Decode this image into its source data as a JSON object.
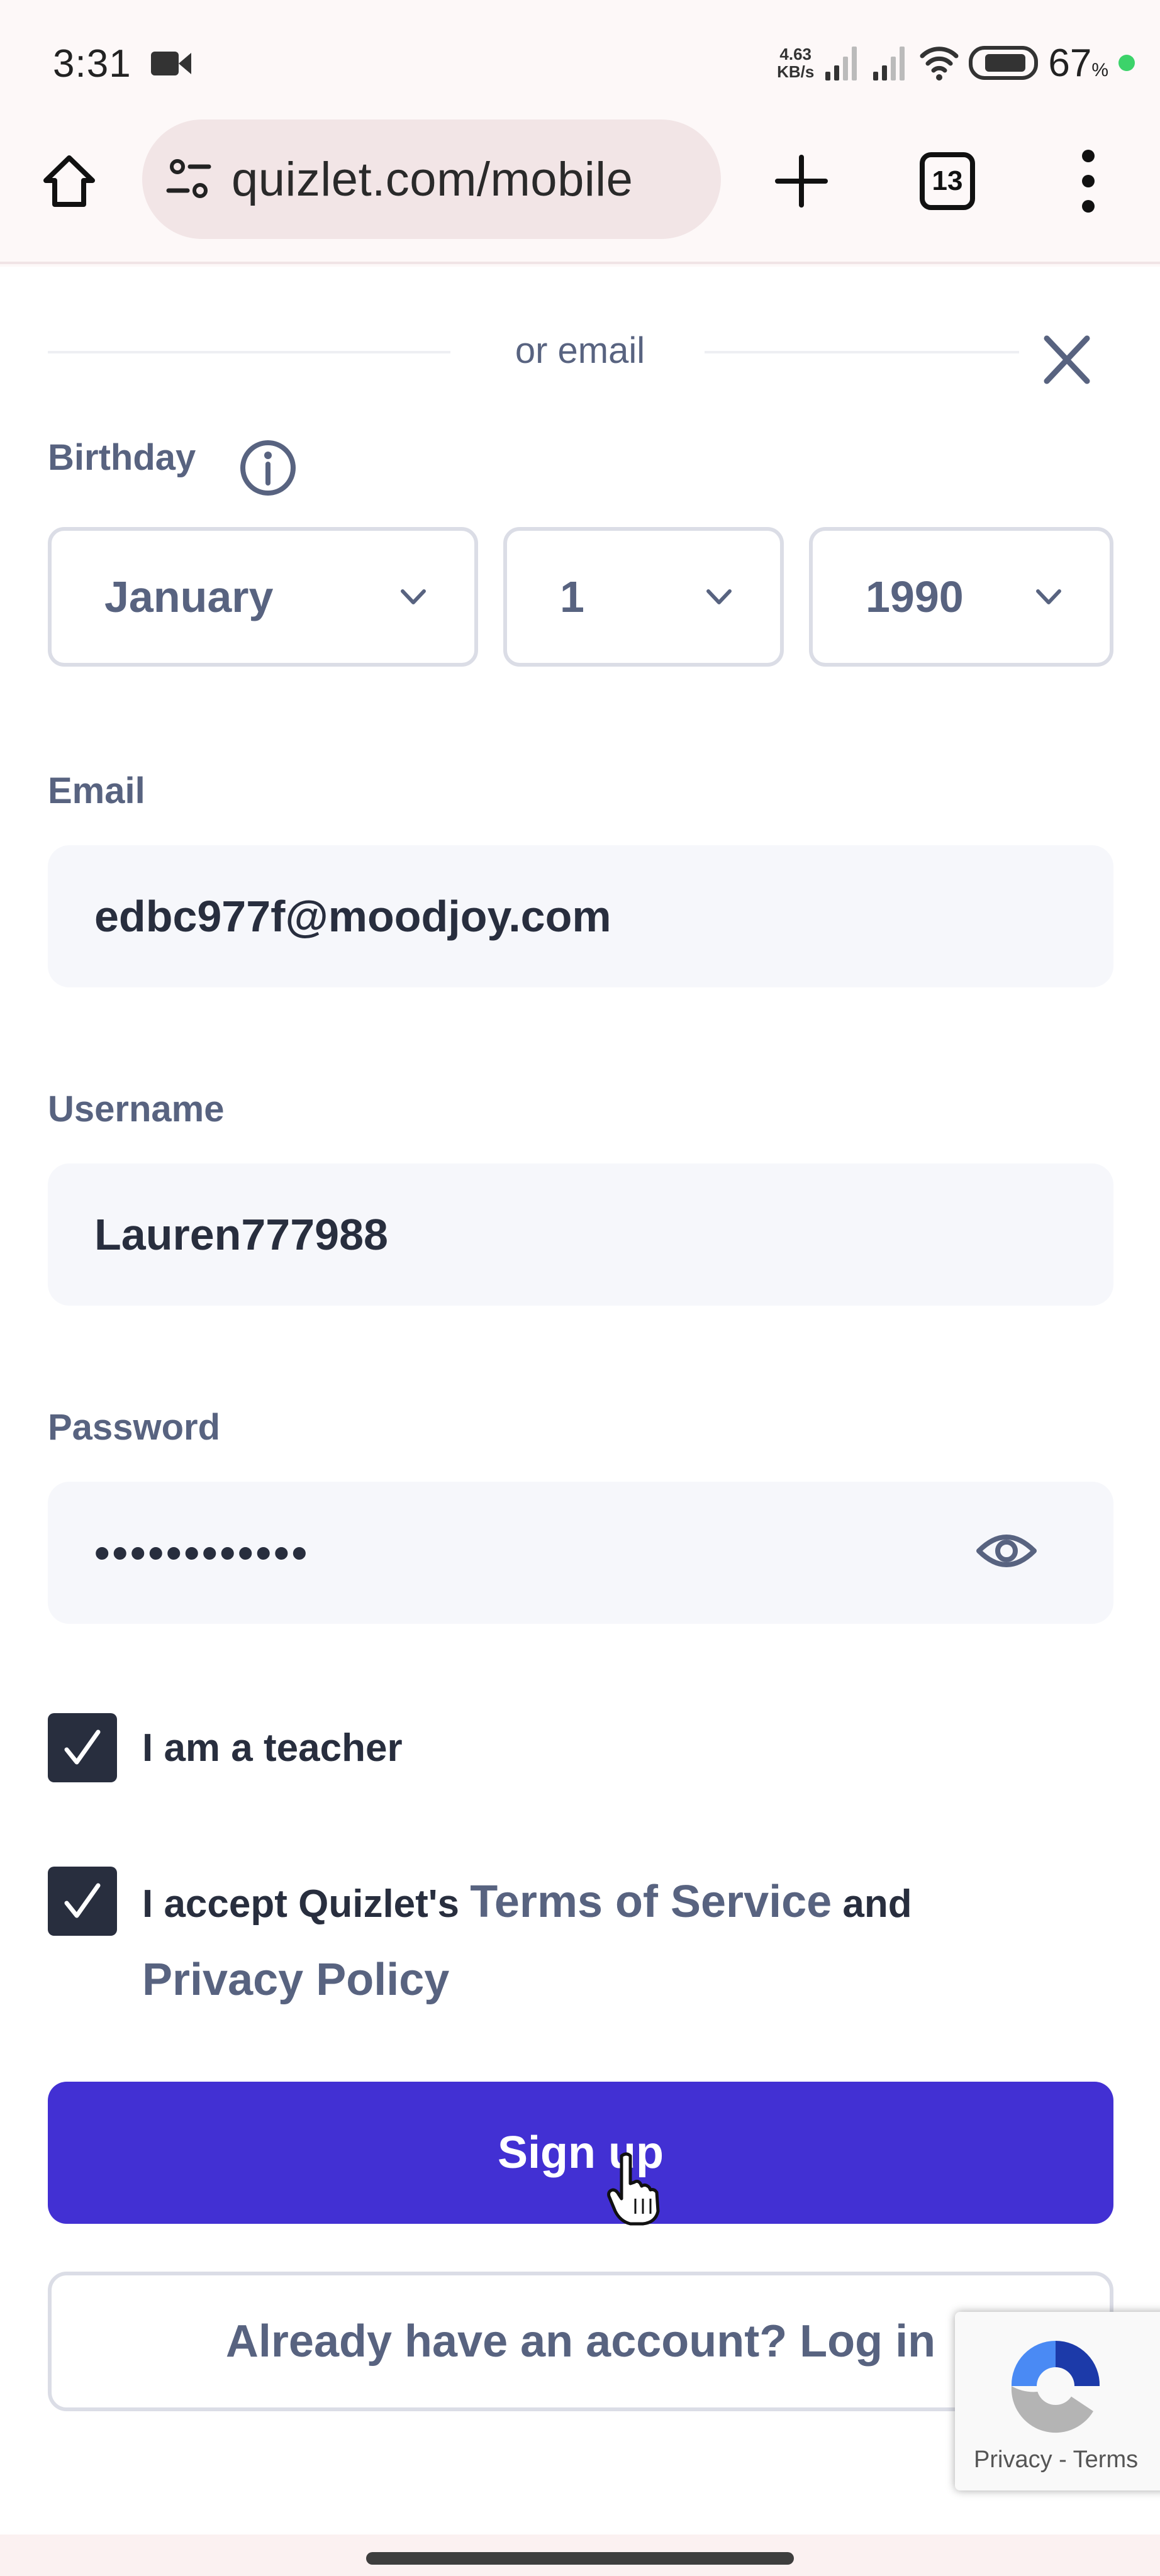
{
  "status_bar": {
    "time": "3:31",
    "net_speed_value": "4.63",
    "net_speed_unit": "KB/s",
    "battery_percent": "67",
    "battery_percent_sign": "%",
    "icons": [
      "screen-record-icon",
      "signal-icon",
      "signal-icon",
      "wifi-icon",
      "battery-icon"
    ],
    "dot_color": "#3cd36a"
  },
  "browser": {
    "url": "quizlet.com/mobile",
    "tab_count": "13",
    "icons": [
      "home-icon",
      "site-settings-icon",
      "new-tab-icon",
      "tabs-icon",
      "more-menu-icon"
    ]
  },
  "form": {
    "divider_text": "or email",
    "birthday": {
      "label": "Birthday",
      "month": "January",
      "day": "1",
      "year": "1990"
    },
    "email": {
      "label": "Email",
      "value": "edbc977f@moodjoy.com"
    },
    "username": {
      "label": "Username",
      "value": "Lauren777988"
    },
    "password": {
      "label": "Password",
      "masked_value": "••••••••••••"
    },
    "teacher_checkbox": {
      "label": "I am a teacher",
      "checked": true
    },
    "terms_checkbox": {
      "prefix": "I accept Quizlet's ",
      "terms_link": "Terms of Service",
      "middle": " and",
      "privacy_link": "Privacy Policy",
      "checked": true
    },
    "signup_button": "Sign up",
    "login_button": "Already have an account? Log in"
  },
  "recaptcha": {
    "text": "Privacy - Terms"
  },
  "colors": {
    "primary": "#4230d3",
    "label": "#586380",
    "text": "#282e3e",
    "input_bg": "#f6f7fb",
    "border": "#dbdde6"
  }
}
